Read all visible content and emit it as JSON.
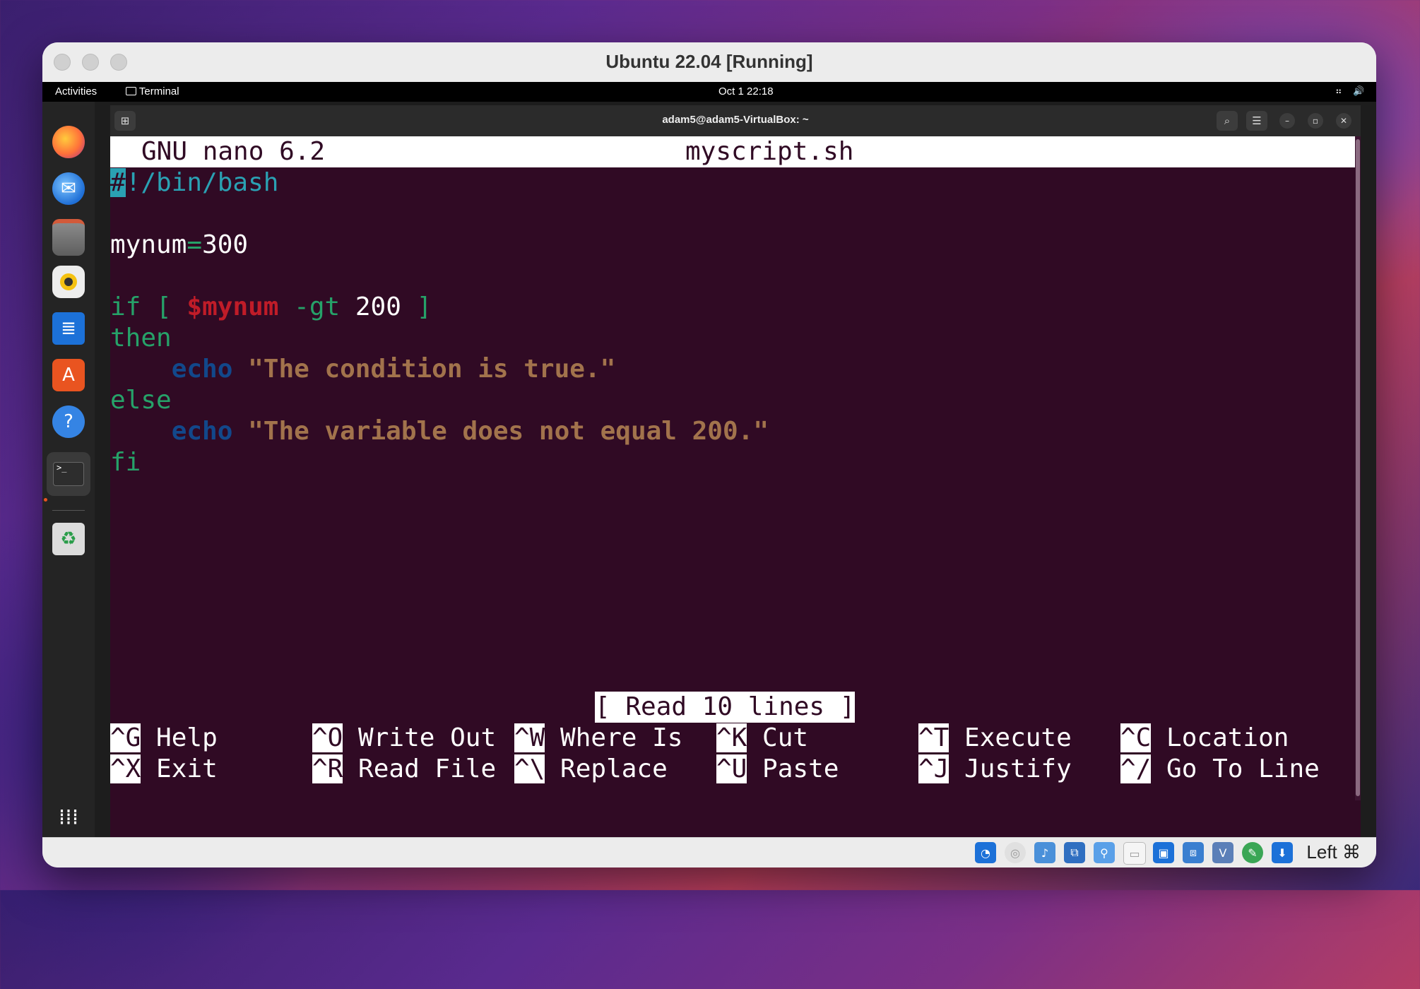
{
  "vm_window": {
    "title": "Ubuntu 22.04 [Running]"
  },
  "topbar": {
    "activities": "Activities",
    "app": "Terminal",
    "clock": "Oct 1  22:18"
  },
  "terminal": {
    "title": "adam5@adam5-VirtualBox: ~"
  },
  "nano": {
    "version": "GNU nano 6.2",
    "filename": "myscript.sh",
    "status": "[ Read 10 lines ]",
    "code": {
      "shebang_first": "#",
      "shebang_rest": "!/bin/bash",
      "assign_name": "mynum",
      "assign_eq": "=",
      "assign_value": "300",
      "if_kw": "if",
      "if_open": "[",
      "if_var": "$mynum",
      "if_op": "-gt",
      "if_num": "200",
      "if_close": "]",
      "then_kw": "then",
      "echo1_cmd": "echo",
      "echo1_str": "\"The condition is true.\"",
      "else_kw": "else",
      "echo2_cmd": "echo",
      "echo2_str": "\"The variable does not equal 200.\"",
      "fi_kw": "fi"
    },
    "shortcuts_row1": [
      {
        "key": "^G",
        "label": "Help"
      },
      {
        "key": "^O",
        "label": "Write Out"
      },
      {
        "key": "^W",
        "label": "Where Is"
      },
      {
        "key": "^K",
        "label": "Cut"
      },
      {
        "key": "^T",
        "label": "Execute"
      },
      {
        "key": "^C",
        "label": "Location"
      }
    ],
    "shortcuts_row2": [
      {
        "key": "^X",
        "label": "Exit"
      },
      {
        "key": "^R",
        "label": "Read File"
      },
      {
        "key": "^\\",
        "label": "Replace"
      },
      {
        "key": "^U",
        "label": "Paste"
      },
      {
        "key": "^J",
        "label": "Justify"
      },
      {
        "key": "^/",
        "label": "Go To Line"
      }
    ]
  },
  "dock": {
    "items": [
      "firefox-icon",
      "thunderbird-icon",
      "files-icon",
      "rhythmbox-icon",
      "writer-icon",
      "software-icon",
      "help-icon",
      "terminal-icon",
      "trash-icon",
      "app-grid-icon"
    ]
  },
  "vbox_statusbar": {
    "host_key": "Left ⌘"
  }
}
